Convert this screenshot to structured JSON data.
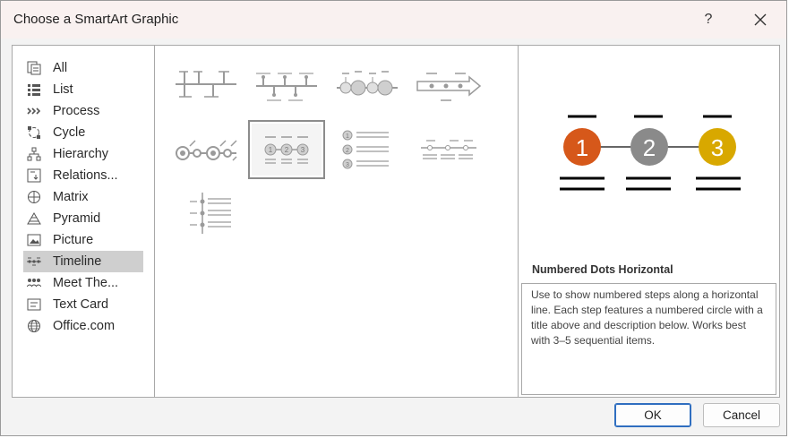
{
  "window": {
    "title": "Choose a SmartArt Graphic",
    "help_label": "?",
    "close_label": "✕"
  },
  "categories": [
    {
      "label": "All",
      "icon": "all-icon",
      "selected": false
    },
    {
      "label": "List",
      "icon": "list-icon",
      "selected": false
    },
    {
      "label": "Process",
      "icon": "process-icon",
      "selected": false
    },
    {
      "label": "Cycle",
      "icon": "cycle-icon",
      "selected": false
    },
    {
      "label": "Hierarchy",
      "icon": "hierarchy-icon",
      "selected": false
    },
    {
      "label": "Relations...",
      "icon": "relationship-icon",
      "selected": false
    },
    {
      "label": "Matrix",
      "icon": "matrix-icon",
      "selected": false
    },
    {
      "label": "Pyramid",
      "icon": "pyramid-icon",
      "selected": false
    },
    {
      "label": "Picture",
      "icon": "picture-icon",
      "selected": false
    },
    {
      "label": "Timeline",
      "icon": "timeline-icon",
      "selected": true
    },
    {
      "label": "Meet The...",
      "icon": "people-icon",
      "selected": false
    },
    {
      "label": "Text Card",
      "icon": "text-card-icon",
      "selected": false
    },
    {
      "label": "Office.com",
      "icon": "globe-icon",
      "selected": false
    }
  ],
  "layouts": [
    {
      "name": "basic-timeline-thumb",
      "selected": false
    },
    {
      "name": "branched-timeline-thumb",
      "selected": false
    },
    {
      "name": "circle-accent-timeline-thumb",
      "selected": false
    },
    {
      "name": "arrow-timeline-thumb",
      "selected": false
    },
    {
      "name": "circle-chain-timeline-thumb",
      "selected": false
    },
    {
      "name": "numbered-dots-horizontal-thumb",
      "selected": true
    },
    {
      "name": "numbered-list-timeline-thumb",
      "selected": false
    },
    {
      "name": "dotted-line-timeline-thumb",
      "selected": false
    },
    {
      "name": "vertical-timeline-thumb",
      "selected": false
    }
  ],
  "preview": {
    "steps": [
      {
        "number": "1",
        "color": "#d6581a"
      },
      {
        "number": "2",
        "color": "#8a8a8a"
      },
      {
        "number": "3",
        "color": "#d8a800"
      }
    ],
    "title": "Numbered Dots Horizontal",
    "description": "Use to show numbered steps along a horizontal line. Each step features a numbered circle with a title above and description below. Works best with 3–5 sequential items."
  },
  "buttons": {
    "ok": "OK",
    "cancel": "Cancel"
  },
  "colors": {
    "selection": "#cfcfcf",
    "accent_border": "#2f6ec0",
    "titlebar": "#f9f1f0"
  }
}
